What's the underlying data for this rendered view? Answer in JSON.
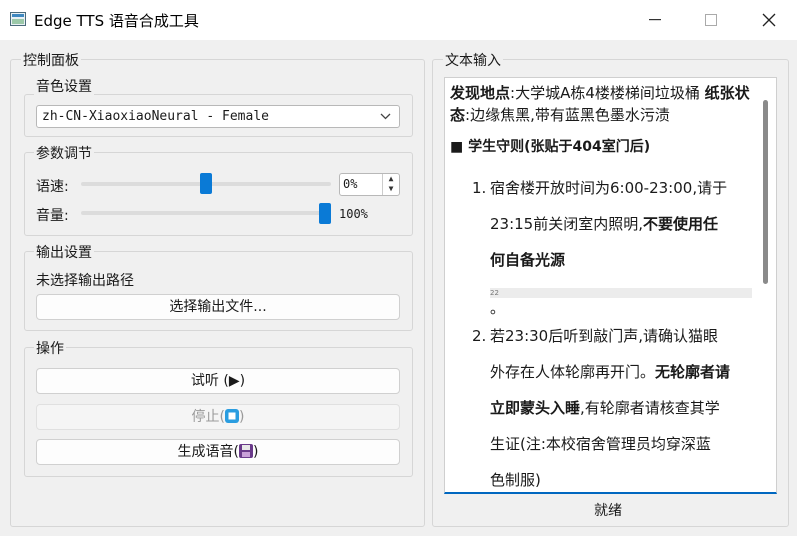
{
  "window": {
    "title": "Edge TTS 语音合成工具"
  },
  "control_panel": {
    "title": "控制面板",
    "voice": {
      "title": "音色设置",
      "selected": "zh-CN-XiaoxiaoNeural - Female"
    },
    "params": {
      "title": "参数调节",
      "speed_label": "语速:",
      "speed_value": "0%",
      "speed_level": 0.5,
      "volume_label": "音量:",
      "volume_value": "100%",
      "volume_level": 1.0
    },
    "output": {
      "title": "输出设置",
      "path_status": "未选择输出路径",
      "choose_button": "选择输出文件..."
    },
    "actions": {
      "title": "操作",
      "preview_button": "试听 (▶)",
      "stop_prefix": "停止(",
      "stop_suffix": ")",
      "generate_prefix": "生成语音(",
      "generate_suffix": ")"
    }
  },
  "text_input": {
    "title": "文本输入",
    "location_label": "发现地点",
    "location_value": ":大学城A栋4楼楼梯间垃圾桶",
    "paper_label": "纸张状态",
    "paper_value": ":边缘焦黑,带有蓝黑色墨水污渍",
    "section_title": "■ 学生守则(张贴于404室门后)",
    "rule1_num": "1.",
    "rule1_line1": "宿舍楼开放时间为6:00-23:00,请于",
    "rule1_line2_a": "23:15前关闭室内照明,",
    "rule1_line2_b": "不要使用任",
    "rule1_line3": "何自备光源",
    "small_mark": "22",
    "period": "。",
    "rule2_num": "2.",
    "rule2_line1": "若23:30后听到敲门声,请确认猫眼",
    "rule2_line2_a": "外存在人体轮廓再开门。",
    "rule2_line2_b": "无轮廓者请",
    "rule2_line3_a": "立即蒙头入睡",
    "rule2_line3_b": ",有轮廓者请核查其学",
    "rule2_line4": "生证(注:本校宿舍管理员均穿深蓝",
    "rule2_line5": "色制服)"
  },
  "status_bar": {
    "text": "就绪"
  },
  "colors": {
    "accent": "#0a7ad6",
    "focus_underline": "#0067c0"
  }
}
